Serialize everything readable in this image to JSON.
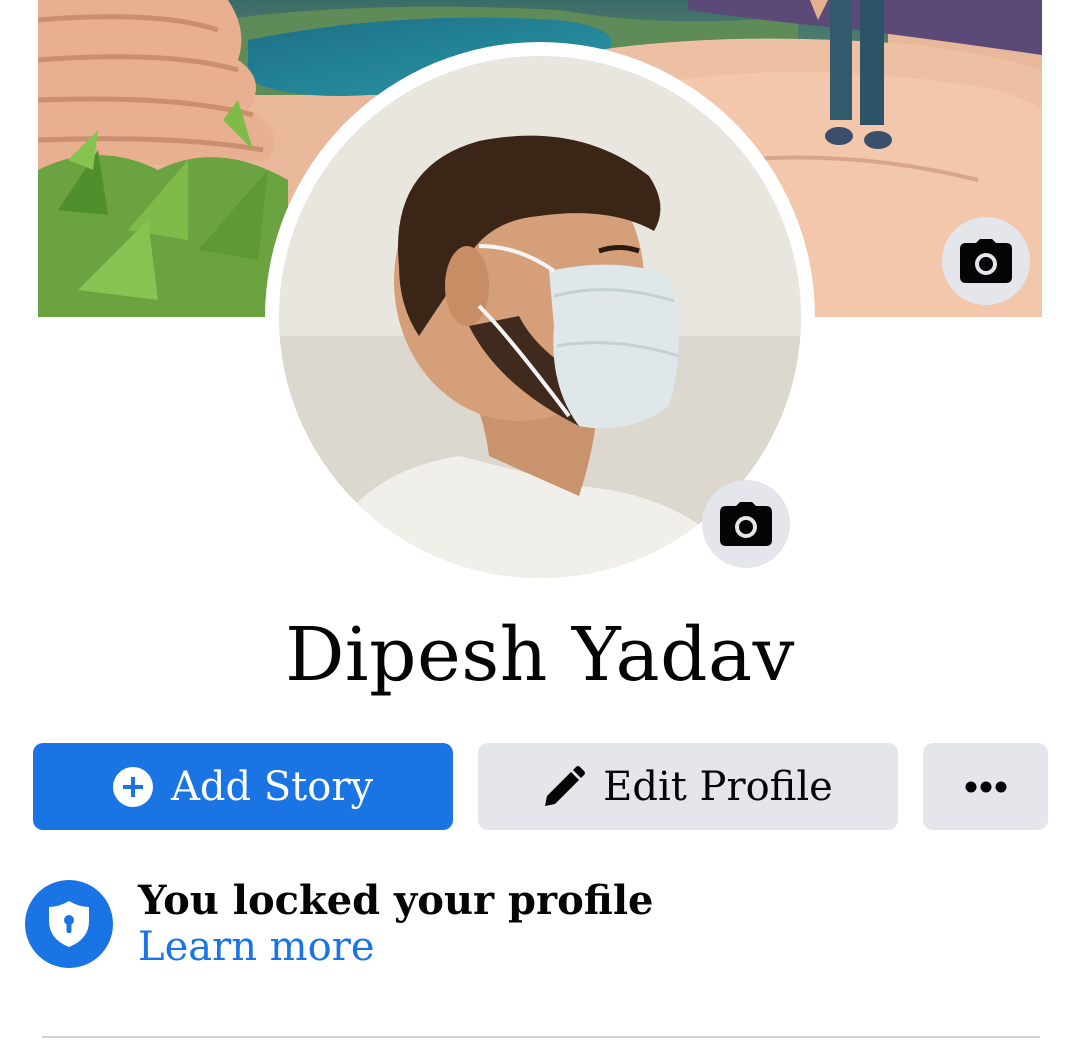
{
  "profile": {
    "name": "Dipesh Yadav"
  },
  "actions": {
    "add_story_label": "Add Story",
    "edit_profile_label": "Edit Profile"
  },
  "lock_notice": {
    "title": "You locked your profile",
    "link": "Learn more"
  },
  "icons": {
    "cover_camera": "camera-icon",
    "avatar_camera": "camera-icon",
    "add_story": "plus-circle-icon",
    "edit_profile": "pencil-icon",
    "more": "more-dots-icon",
    "lock": "shield-keyhole-icon"
  },
  "colors": {
    "accent": "#1b74e4",
    "button_gray": "#e4e6eb",
    "text": "#050505"
  }
}
